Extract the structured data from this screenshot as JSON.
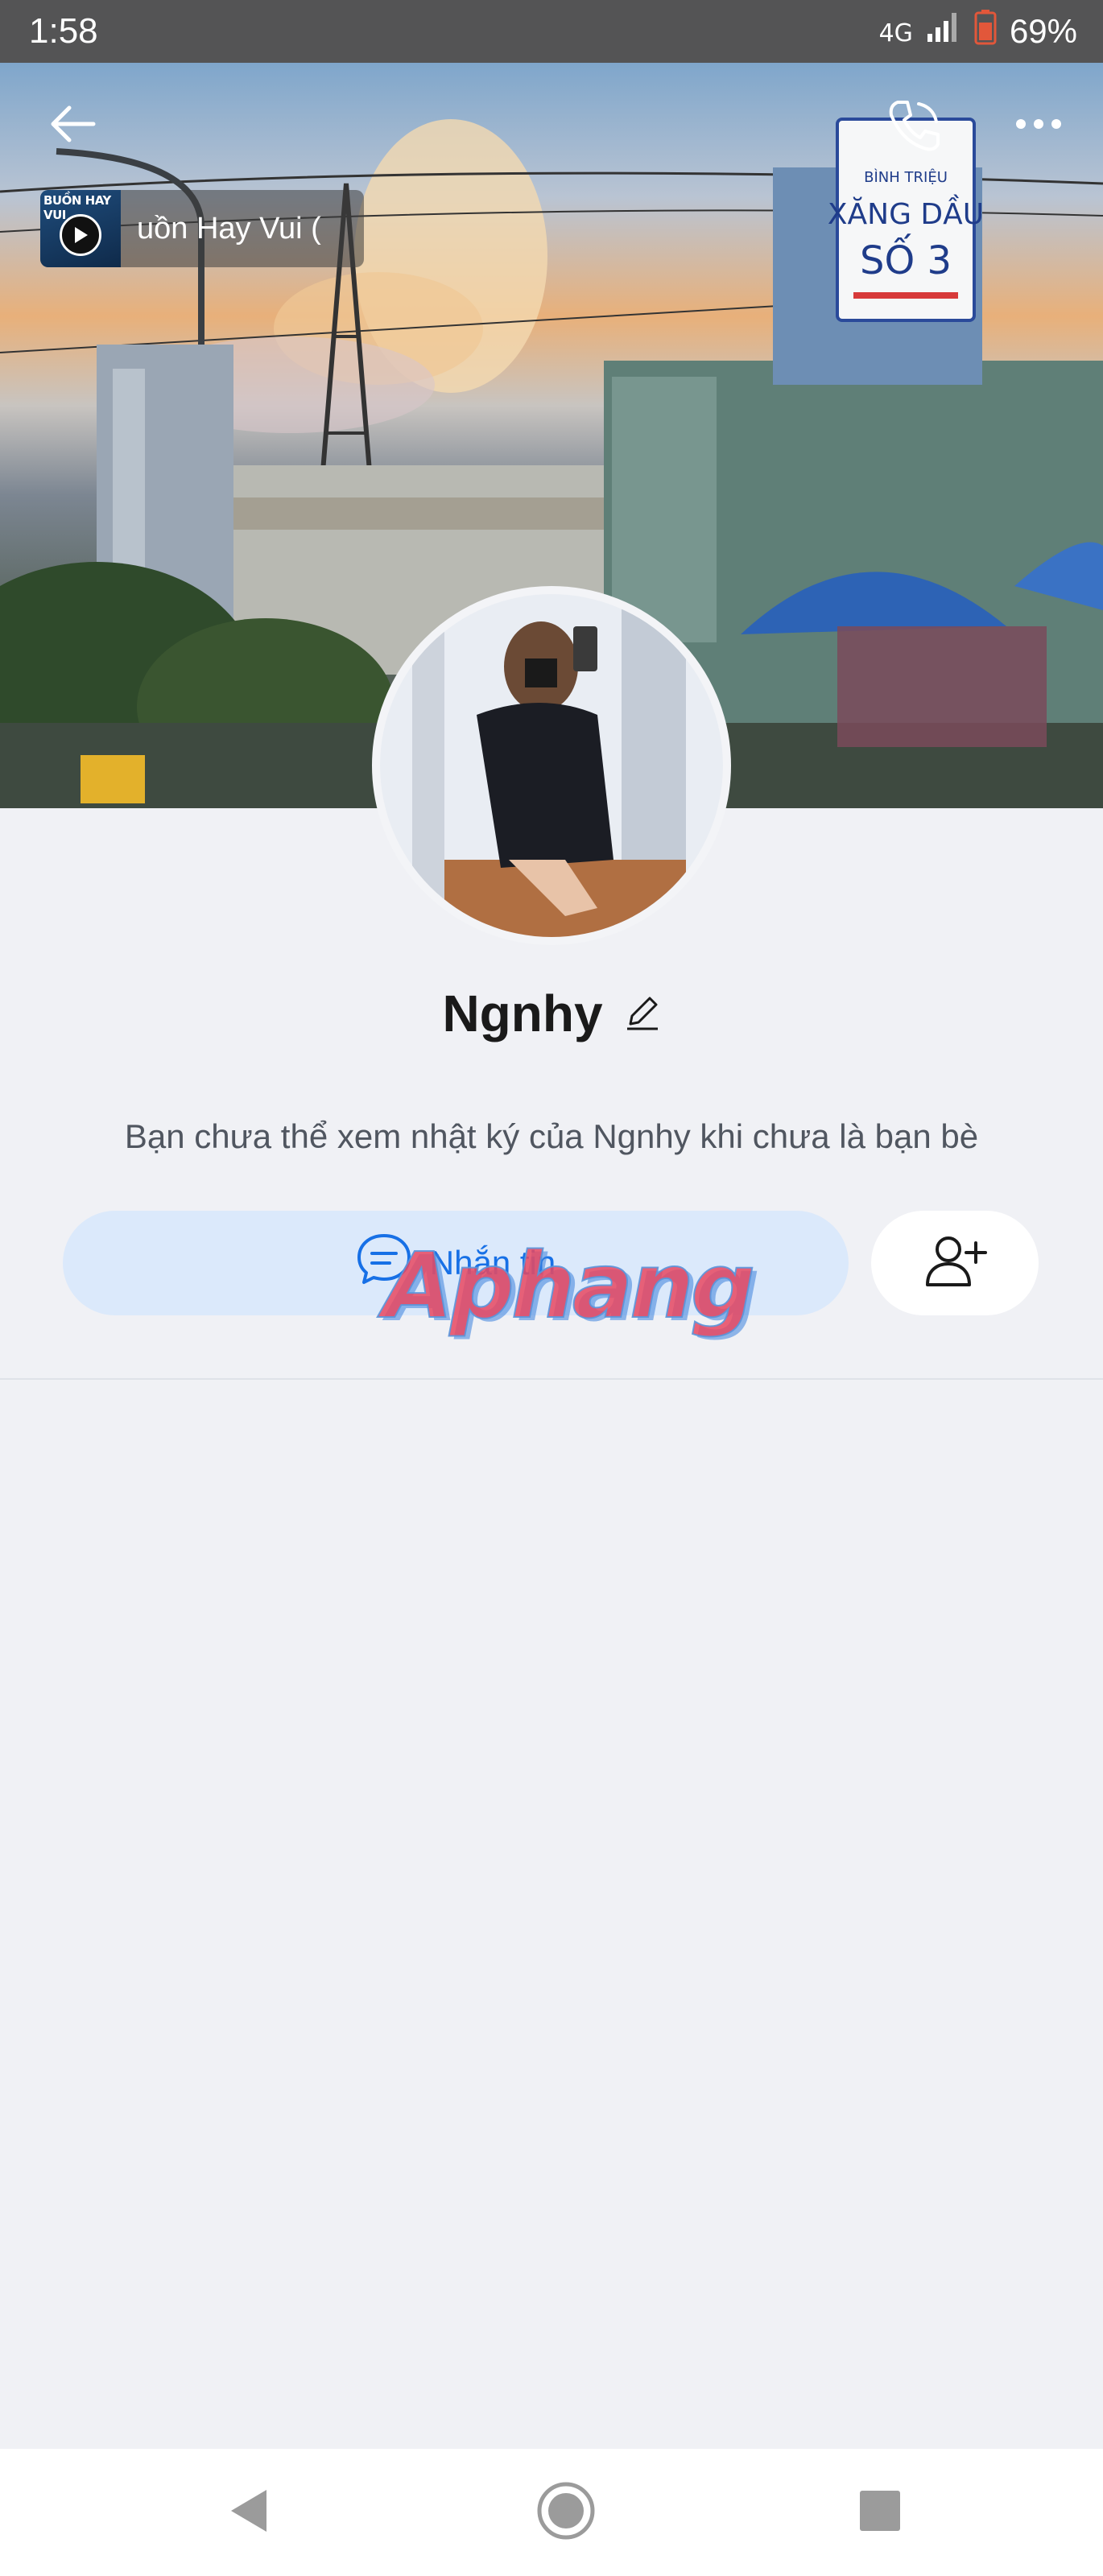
{
  "status_bar": {
    "time": "1:58",
    "network": "4G",
    "battery": "69%",
    "icons": [
      "signal-icon",
      "battery-icon"
    ]
  },
  "header": {
    "back_icon": "back-arrow-icon",
    "call_icon": "phone-icon",
    "more_icon": "more-dots-icon"
  },
  "cover": {
    "sign_line1": "XĂNG DẦU",
    "sign_line2": "SỐ 3",
    "sign_brand": "BÌNH TRIỆU"
  },
  "music": {
    "thumb_label": "BUỒN HAY VUI",
    "title": "uồn Hay Vui ("
  },
  "profile": {
    "name": "Ngnhy",
    "edit_icon": "pencil-icon",
    "diary_note": "Bạn chưa thể xem nhật ký của Ngnhy khi chưa là bạn bè"
  },
  "actions": {
    "message_label": "Nhắn tin",
    "message_icon": "chat-bubble-icon",
    "add_friend_icon": "add-user-icon"
  },
  "watermark": "Aphang",
  "nav": {
    "back_icon": "triangle-back-icon",
    "home_icon": "circle-home-icon",
    "recents_icon": "square-recents-icon"
  },
  "colors": {
    "accent": "#1770e6",
    "message_bg": "#dbe9fb",
    "page_bg": "#f0f1f5"
  }
}
